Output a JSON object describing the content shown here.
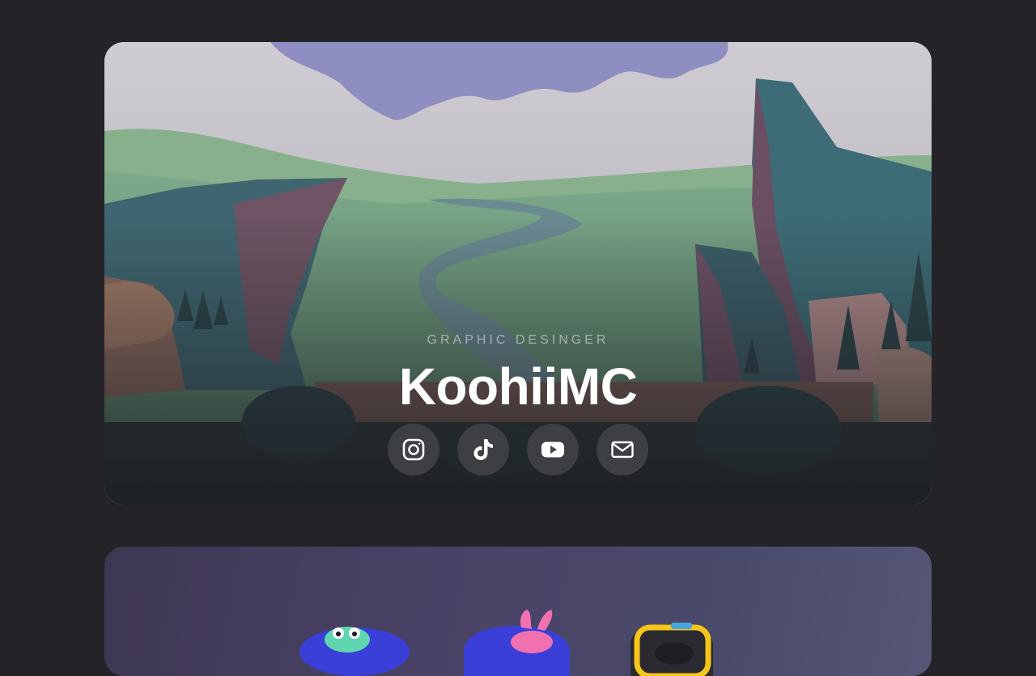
{
  "profile": {
    "subtitle": "GRAPHIC DESINGER",
    "name": "KoohiiMC"
  },
  "socials": [
    {
      "name": "instagram",
      "icon": "instagram-icon"
    },
    {
      "name": "tiktok",
      "icon": "tiktok-icon"
    },
    {
      "name": "youtube",
      "icon": "youtube-icon"
    },
    {
      "name": "email",
      "icon": "mail-icon"
    }
  ],
  "colors": {
    "page_background": "#242428",
    "title": "#ffffff",
    "button_background": "#46464c"
  }
}
